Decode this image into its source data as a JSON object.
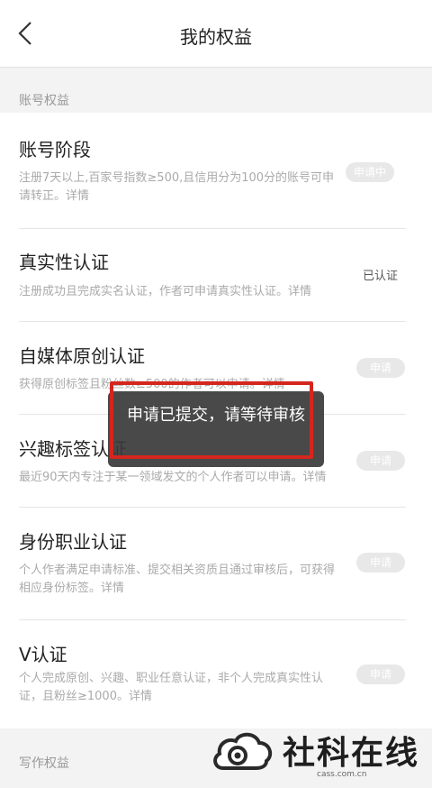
{
  "header": {
    "title": "我的权益"
  },
  "sections": [
    {
      "label": "账号权益"
    },
    {
      "label": "写作权益"
    }
  ],
  "items": [
    {
      "title": "账号阶段",
      "desc": "注册7天以上,百家号指数≥500,且信用分为100分的账号可申请转正。详情",
      "status": "申请中"
    },
    {
      "title": "真实性认证",
      "desc": "注册成功且完成实名认证，作者可申请真实性认证。详情",
      "status": "已认证"
    },
    {
      "title": "自媒体原创认证",
      "desc": "获得原创标签且粉丝数≥500的作者可以申请。详情",
      "status": "申请"
    },
    {
      "title": "兴趣标签认证",
      "desc": "最近90天内专注于某一领域发文的个人作者可以申请。详情",
      "status": "申请"
    },
    {
      "title": "身份职业认证",
      "desc": "个人作者满足申请标准、提交相关资质且通过审核后，可获得相应身份标签。详情",
      "status": "申请"
    },
    {
      "title": "V认证",
      "desc": "个人完成原创、兴趣、职业任意认证，非个人完成真实性认证，且粉丝≥1000。详情",
      "status": "申请"
    }
  ],
  "toast": {
    "message": "申请已提交，请等待审核"
  },
  "watermark": {
    "brand": "社科在线",
    "url": "cass.com.cn"
  }
}
